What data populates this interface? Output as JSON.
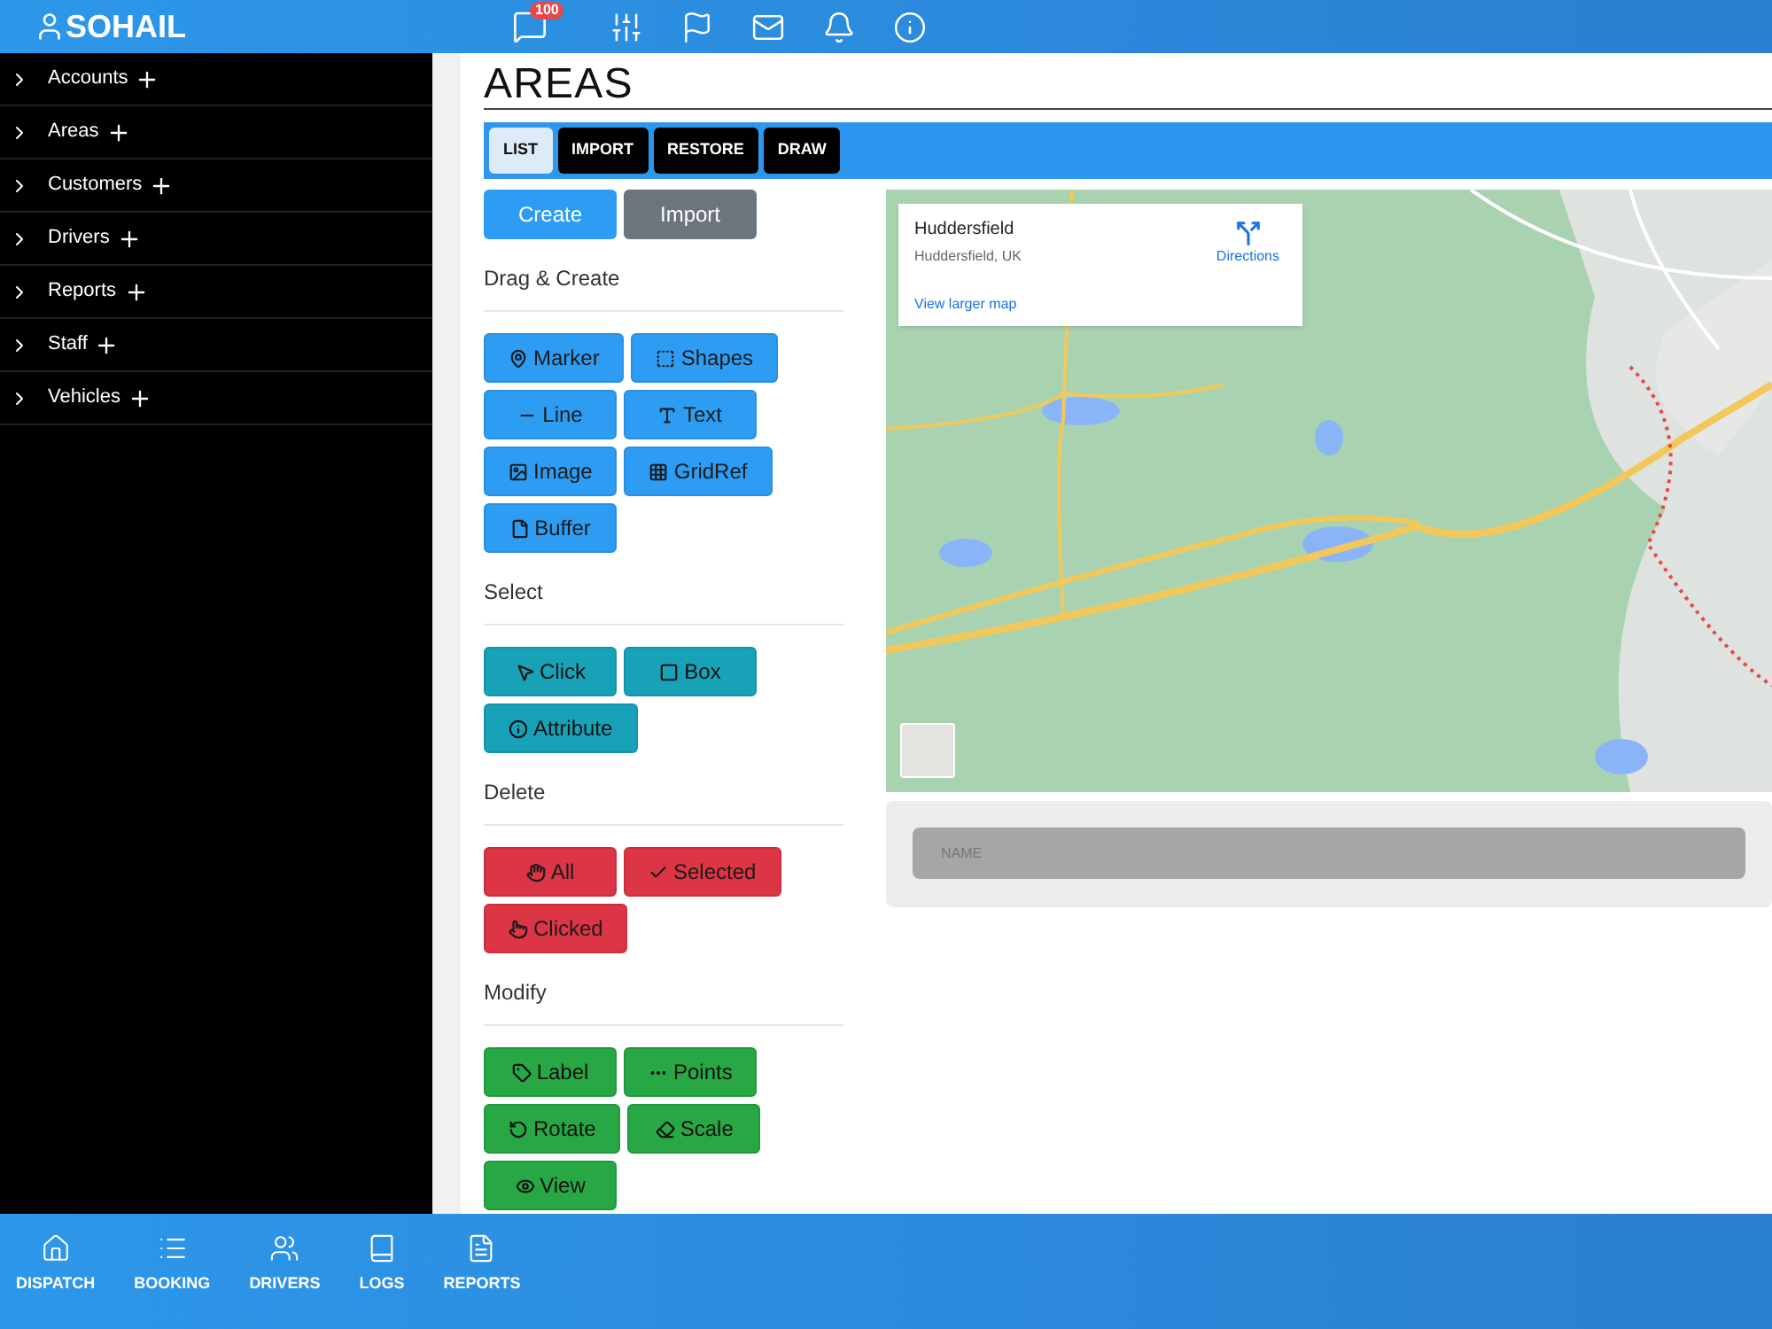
{
  "header": {
    "user": "SOHAIL",
    "message_badge": "100"
  },
  "sidebar": {
    "items": [
      {
        "label": "Accounts",
        "expanded": false
      },
      {
        "label": "Areas",
        "expanded": false
      },
      {
        "label": "Customers",
        "expanded": false
      },
      {
        "label": "Drivers",
        "expanded": false
      },
      {
        "label": "Reports",
        "expanded": false
      },
      {
        "label": "Staff",
        "expanded": false
      },
      {
        "label": "Vehicles",
        "expanded": false
      }
    ]
  },
  "page_title": "AREAS",
  "tabs": [
    {
      "label": "LIST",
      "selected": true
    },
    {
      "label": "IMPORT",
      "selected": false
    },
    {
      "label": "RESTORE",
      "selected": false
    },
    {
      "label": "DRAW",
      "selected": false
    }
  ],
  "actions": [
    {
      "label": "Create",
      "kind": "primary"
    },
    {
      "label": "Import",
      "kind": "secondary"
    }
  ],
  "tool_sections": [
    {
      "title": "Drag & Create",
      "kind": "info",
      "buttons": [
        "Marker",
        "Shapes",
        "Line",
        "Text",
        "Image",
        "GridRef",
        "Buffer"
      ]
    },
    {
      "title": "Select",
      "kind": "teal",
      "buttons": [
        "Click",
        "Box",
        "Attribute"
      ]
    },
    {
      "title": "Delete",
      "kind": "danger",
      "buttons": [
        "All",
        "Selected",
        "Clicked"
      ]
    },
    {
      "title": "Modify",
      "kind": "success",
      "buttons": [
        "Label",
        "Points",
        "Rotate",
        "Scale",
        "View"
      ]
    }
  ],
  "map": {
    "kind": "picture",
    "place_card": {
      "title": "Huddersfield",
      "subtitle": "Huddersfield, UK",
      "directions": "Directions",
      "link": "View larger map"
    }
  },
  "name_field": {
    "placeholder": "NAME"
  },
  "bottom_nav": [
    {
      "label": "DISPATCH"
    },
    {
      "label": "BOOKING"
    },
    {
      "label": "DRIVERS"
    },
    {
      "label": "LOGS"
    },
    {
      "label": "REPORTS"
    }
  ]
}
